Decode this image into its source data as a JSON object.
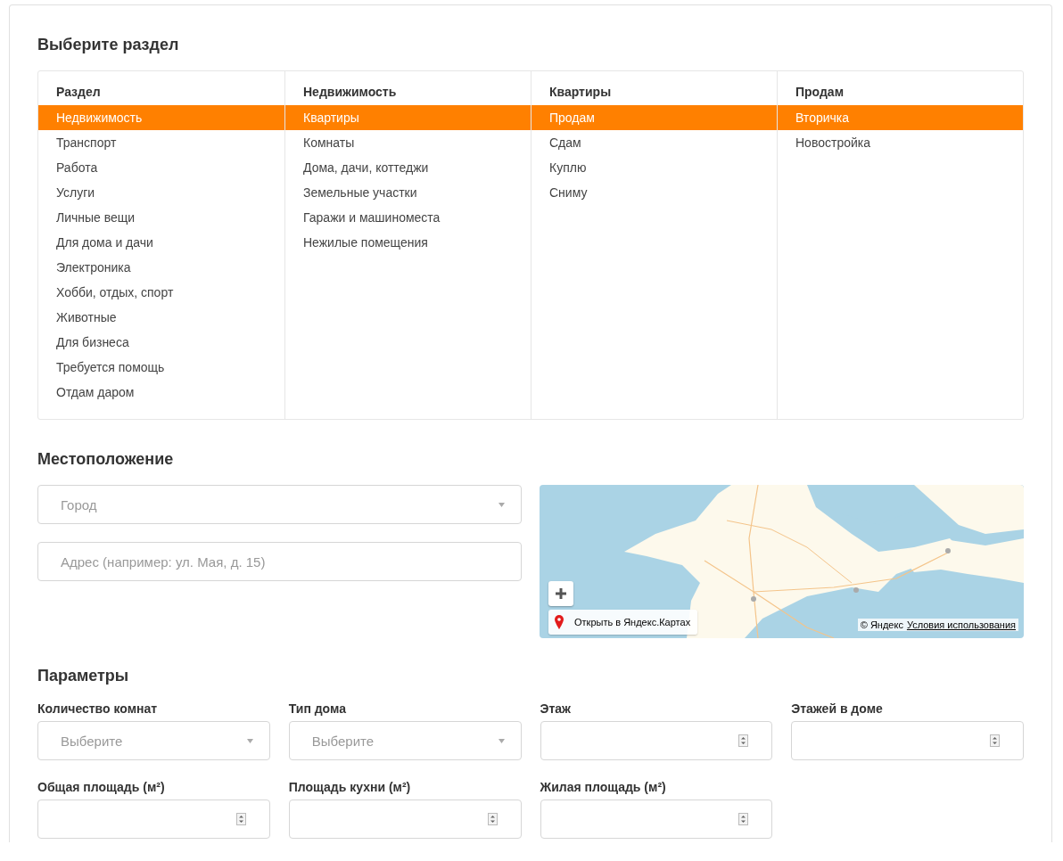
{
  "sections": {
    "title": "Выберите раздел",
    "columns": [
      {
        "heading": "Раздел",
        "items": [
          {
            "label": "Недвижимость",
            "selected": true
          },
          {
            "label": "Транспорт",
            "selected": false
          },
          {
            "label": "Работа",
            "selected": false
          },
          {
            "label": "Услуги",
            "selected": false
          },
          {
            "label": "Личные вещи",
            "selected": false
          },
          {
            "label": "Для дома и дачи",
            "selected": false
          },
          {
            "label": "Электроника",
            "selected": false
          },
          {
            "label": "Хобби, отдых, спорт",
            "selected": false
          },
          {
            "label": "Животные",
            "selected": false
          },
          {
            "label": "Для бизнеса",
            "selected": false
          },
          {
            "label": "Требуется помощь",
            "selected": false
          },
          {
            "label": "Отдам даром",
            "selected": false
          }
        ]
      },
      {
        "heading": "Недвижимость",
        "items": [
          {
            "label": "Квартиры",
            "selected": true
          },
          {
            "label": "Комнаты",
            "selected": false
          },
          {
            "label": "Дома, дачи, коттеджи",
            "selected": false
          },
          {
            "label": "Земельные участки",
            "selected": false
          },
          {
            "label": "Гаражи и машиноместа",
            "selected": false
          },
          {
            "label": "Нежилые помещения",
            "selected": false
          }
        ]
      },
      {
        "heading": "Квартиры",
        "items": [
          {
            "label": "Продам",
            "selected": true
          },
          {
            "label": "Сдам",
            "selected": false
          },
          {
            "label": "Куплю",
            "selected": false
          },
          {
            "label": "Сниму",
            "selected": false
          }
        ]
      },
      {
        "heading": "Продам",
        "items": [
          {
            "label": "Вторичка",
            "selected": true
          },
          {
            "label": "Новостройка",
            "selected": false
          }
        ]
      }
    ]
  },
  "location": {
    "title": "Местоположение",
    "city": {
      "placeholder": "Город"
    },
    "address": {
      "placeholder": "Адрес (например: ул. Мая, д. 15)"
    },
    "map": {
      "kind": "picture",
      "open_link": "Открыть в Яндекс.Картах",
      "copyright": "© Яндекс",
      "terms": "Условия использования"
    }
  },
  "parameters": {
    "title": "Параметры",
    "fields": [
      {
        "label": "Количество комнат",
        "kind": "select",
        "placeholder": "Выберите"
      },
      {
        "label": "Тип дома",
        "kind": "select",
        "placeholder": "Выберите"
      },
      {
        "label": "Этаж",
        "kind": "number"
      },
      {
        "label": "Этажей в доме",
        "kind": "number"
      },
      {
        "label": "Общая площадь (м²)",
        "kind": "number"
      },
      {
        "label": "Площадь кухни (м²)",
        "kind": "number"
      },
      {
        "label": "Жилая площадь (м²)",
        "kind": "number"
      }
    ]
  }
}
